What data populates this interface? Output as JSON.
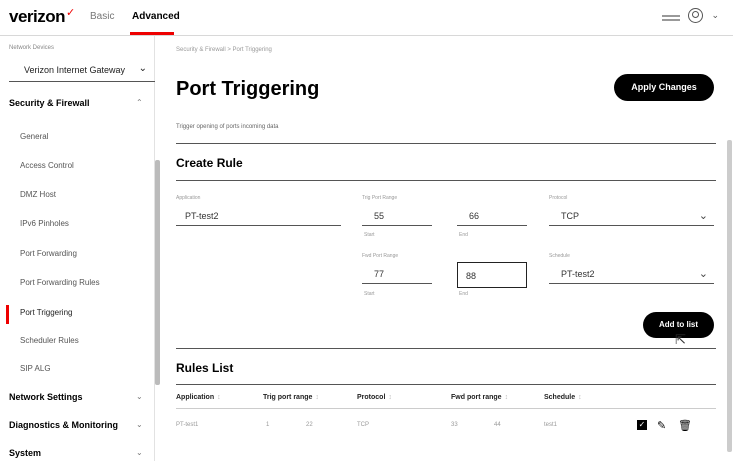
{
  "topbar": {
    "brand": "verizon",
    "brand_mark": "✓",
    "tabs": [
      {
        "label": "Basic"
      },
      {
        "label": "Advanced"
      }
    ]
  },
  "sidebar": {
    "gateway_label": "Network Devices",
    "gateway_value": "Verizon Internet Gateway",
    "sections": [
      {
        "label": "Security & Firewall"
      },
      {
        "label": "Network Settings"
      },
      {
        "label": "Diagnostics & Monitoring"
      },
      {
        "label": "System"
      }
    ],
    "items": [
      {
        "label": "General"
      },
      {
        "label": "Access Control"
      },
      {
        "label": "DMZ Host"
      },
      {
        "label": "IPv6 Pinholes"
      },
      {
        "label": "Port Forwarding"
      },
      {
        "label": "Port Forwarding Rules"
      },
      {
        "label": "Port Triggering"
      },
      {
        "label": "Scheduler Rules"
      },
      {
        "label": "SIP ALG"
      }
    ]
  },
  "main": {
    "breadcrumb": "Security & Firewall  >  Port Triggering",
    "title": "Port Triggering",
    "apply_label": "Apply Changes",
    "description": "Trigger opening of ports incoming data",
    "create_rule": {
      "heading": "Create Rule",
      "application_label": "Application",
      "application_value": "PT-test2",
      "trig_label": "Trig Port Range",
      "trig_start": "55",
      "trig_end": "66",
      "fwd_label": "Fwd Port Range",
      "fwd_start": "77",
      "fwd_end": "88",
      "start_label": "Start",
      "end_label": "End",
      "protocol_label": "Protocol",
      "protocol_value": "TCP",
      "schedule_label": "Schedule",
      "schedule_value": "PT-test2",
      "add_label": "Add to list"
    },
    "rules_list": {
      "heading": "Rules List",
      "columns": [
        "Application",
        "Trig port range",
        "Protocol",
        "Fwd port range",
        "Schedule"
      ],
      "rows": [
        {
          "application": "PT-test1",
          "trig_start": "1",
          "trig_end": "22",
          "protocol": "TCP",
          "fwd_start": "33",
          "fwd_end": "44",
          "schedule": "test1"
        }
      ]
    }
  }
}
